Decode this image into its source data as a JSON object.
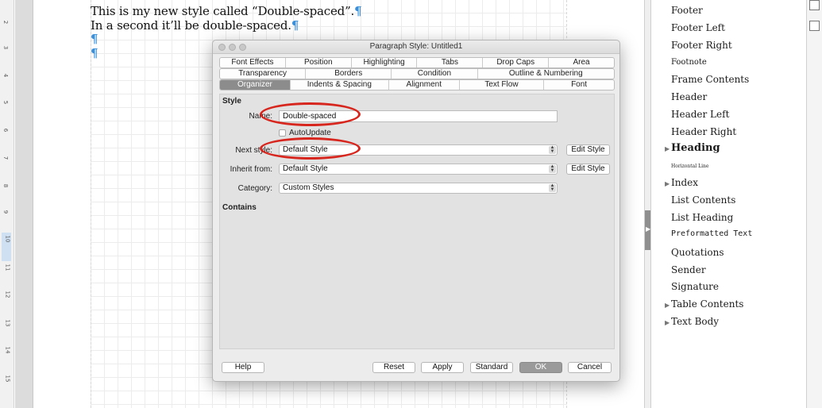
{
  "document": {
    "lines": [
      "This is my new style called “Double-spaced”.",
      "In a second it’ll be double-spaced."
    ],
    "pilcrow": "¶",
    "ruler_numbers": [
      "2",
      "3",
      "4",
      "5",
      "6",
      "7",
      "8",
      "9",
      "10",
      "11",
      "12",
      "13",
      "14",
      "15"
    ]
  },
  "styles_list": {
    "items": [
      {
        "label": "Footer",
        "expandable": false
      },
      {
        "label": "Footer Left",
        "expandable": false
      },
      {
        "label": "Footer Right",
        "expandable": false
      },
      {
        "label": "Footnote",
        "expandable": false
      },
      {
        "label": "Frame Contents",
        "expandable": false
      },
      {
        "label": "Header",
        "expandable": false
      },
      {
        "label": "Header Left",
        "expandable": false
      },
      {
        "label": "Header Right",
        "expandable": false
      },
      {
        "label": "Heading",
        "expandable": true
      },
      {
        "label": "Horizontal Line",
        "expandable": false
      },
      {
        "label": "Index",
        "expandable": true
      },
      {
        "label": "List Contents",
        "expandable": false
      },
      {
        "label": "List Heading",
        "expandable": false
      },
      {
        "label": "Preformatted Text",
        "expandable": false
      },
      {
        "label": "Quotations",
        "expandable": false
      },
      {
        "label": "Sender",
        "expandable": false
      },
      {
        "label": "Signature",
        "expandable": false
      },
      {
        "label": "Table Contents",
        "expandable": true
      },
      {
        "label": "Text Body",
        "expandable": true
      }
    ]
  },
  "dialog": {
    "title": "Paragraph Style: Untitled1",
    "tabs_row1": [
      "Font Effects",
      "Position",
      "Highlighting",
      "Tabs",
      "Drop Caps",
      "Area"
    ],
    "tabs_row2": [
      "Transparency",
      "Borders",
      "Condition",
      "Outline & Numbering"
    ],
    "tabs_row3": [
      "Organizer",
      "Indents & Spacing",
      "Alignment",
      "Text Flow",
      "Font"
    ],
    "active_tab": "Organizer",
    "style_section": "Style",
    "name_label": "Name:",
    "name_value": "Double-spaced",
    "autoupdate_label": "AutoUpdate",
    "autoupdate_checked": false,
    "next_style_label": "Next style:",
    "next_style_value": "Default Style",
    "inherit_label": "Inherit from:",
    "inherit_value": "Default Style",
    "category_label": "Category:",
    "category_value": "Custom Styles",
    "edit_style_label": "Edit Style",
    "contains_section": "Contains",
    "buttons": {
      "help": "Help",
      "reset": "Reset",
      "apply": "Apply",
      "standard": "Standard",
      "ok": "OK",
      "cancel": "Cancel"
    }
  },
  "colors": {
    "annotation": "#d7261e",
    "pilcrow": "#3a8fd8",
    "active_tab": "#8c8c8c"
  }
}
